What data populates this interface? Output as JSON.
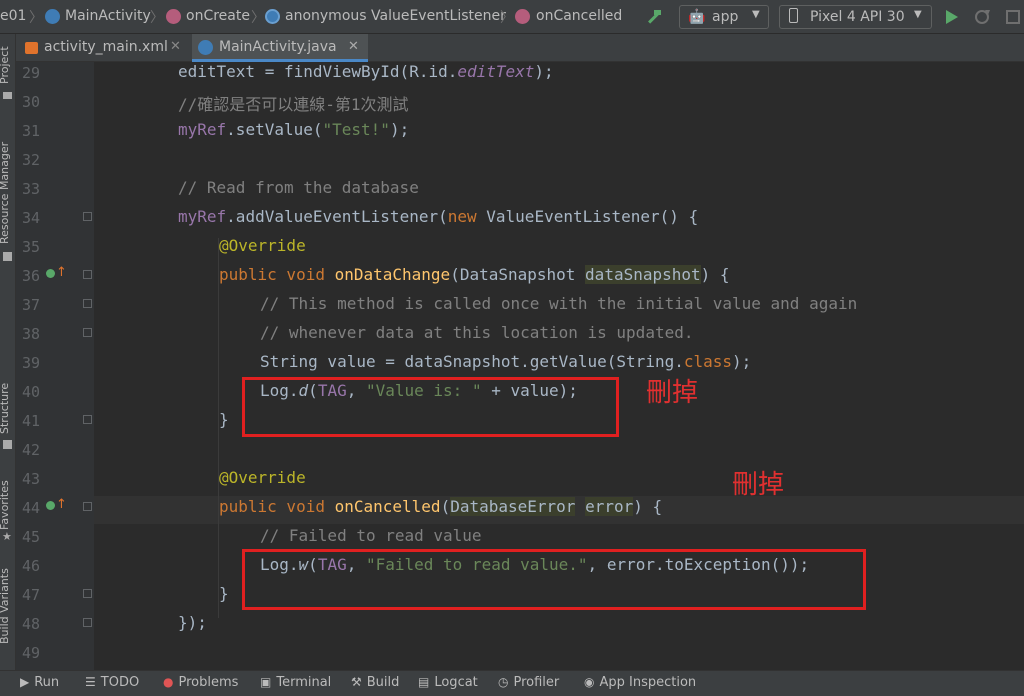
{
  "breadcrumb": {
    "items": [
      {
        "label": "e01"
      },
      {
        "label": "MainActivity",
        "icon": "class-icon"
      },
      {
        "label": "onCreate",
        "icon": "method-icon"
      },
      {
        "label": "anonymous ValueEventListener",
        "icon": "anonymous-class-icon"
      },
      {
        "label": "onCancelled",
        "icon": "method-icon"
      }
    ]
  },
  "toolbar": {
    "run_config": "app",
    "device": "Pixel 4 API 30"
  },
  "tabs": [
    {
      "label": "activity_main.xml",
      "active": false
    },
    {
      "label": "MainActivity.java",
      "active": true
    }
  ],
  "left_tools": [
    "Project",
    "Resource Manager",
    "Structure",
    "Favorites",
    "Build Variants"
  ],
  "editor": {
    "line_numbers": [
      "29",
      "30",
      "31",
      "32",
      "33",
      "34",
      "35",
      "36",
      "37",
      "38",
      "39",
      "40",
      "41",
      "42",
      "43",
      "44",
      "45",
      "46",
      "47",
      "48",
      "49"
    ],
    "annotations": [
      "刪掉",
      "刪掉"
    ],
    "code_lines": {
      "l29_a": "editText = findViewById(R.id.",
      "l29_b": "editText",
      "l29_c": ");",
      "l30": "//確認是否可以連線-第1次測試",
      "l31_a": "myRef",
      "l31_b": ".setValue(",
      "l31_c": "\"Test!\"",
      "l31_d": ");",
      "l33": "// Read from the database",
      "l34_a": "myRef",
      "l34_b": ".addValueEventListener(",
      "l34_c": "new",
      "l34_d": " ValueEventListener() {",
      "l35": "@Override",
      "l36_a": "public void ",
      "l36_b": "onDataChange",
      "l36_c": "(DataSnapshot ",
      "l36_d": "dataSnapshot",
      "l36_e": ") {",
      "l37": "// This method is called once with the initial value and again",
      "l38": "// whenever data at this location is updated.",
      "l39_a": "String value = dataSnapshot.getValue(String.",
      "l39_b": "class",
      "l39_c": ");",
      "l40_a": "Log.",
      "l40_b": "d",
      "l40_c": "(",
      "l40_d": "TAG",
      "l40_e": ", ",
      "l40_f": "\"Value is: \"",
      "l40_g": " + value);",
      "l41": "}",
      "l43": "@Override",
      "l44_a": "public void ",
      "l44_b": "onCancelled",
      "l44_c": "(",
      "l44_d": "DatabaseError",
      "l44_e": " ",
      "l44_f": "error",
      "l44_g": ") {",
      "l45": "// Failed to read value",
      "l46_a": "Log.",
      "l46_b": "w",
      "l46_c": "(",
      "l46_d": "TAG",
      "l46_e": ", ",
      "l46_f": "\"Failed to read value.\"",
      "l46_g": ", error.toException());",
      "l47": "}",
      "l48": "});"
    }
  },
  "bottom_tools": [
    {
      "label": "Run",
      "icon": "run-icon"
    },
    {
      "label": "TODO",
      "icon": "todo-icon"
    },
    {
      "label": "Problems",
      "icon": "problems-icon"
    },
    {
      "label": "Terminal",
      "icon": "terminal-icon"
    },
    {
      "label": "Build",
      "icon": "build-icon"
    },
    {
      "label": "Logcat",
      "icon": "logcat-icon"
    },
    {
      "label": "Profiler",
      "icon": "profiler-icon"
    },
    {
      "label": "App Inspection",
      "icon": "app-inspection-icon"
    }
  ],
  "colors": {
    "keyword": "#cc7832",
    "string": "#6a8759",
    "comment": "#808080",
    "method": "#ffc66d",
    "annotation": "#bbb529",
    "field": "#9876aa",
    "highlight_box": "#e02020",
    "run_green": "#59a869"
  }
}
